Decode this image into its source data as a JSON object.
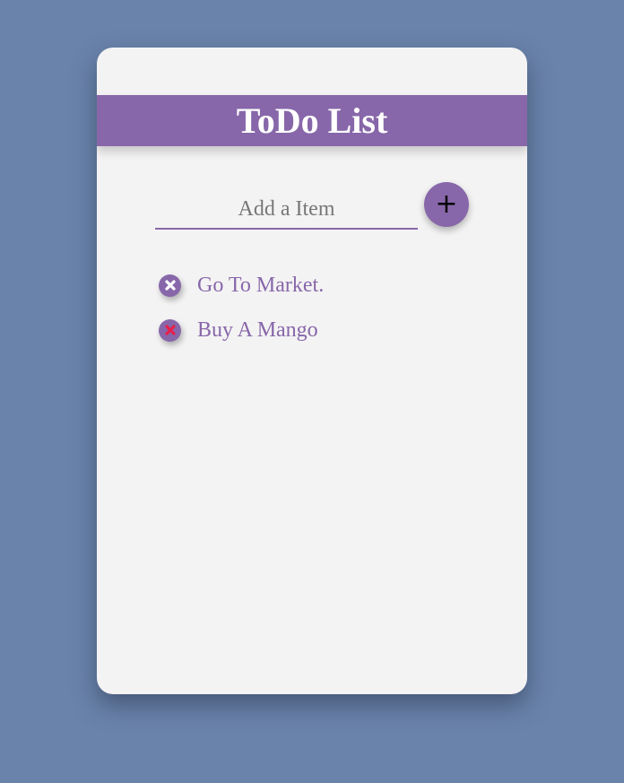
{
  "header": {
    "title": "ToDo List"
  },
  "input": {
    "placeholder": "Add a Item",
    "value": ""
  },
  "add_button": {
    "label": "+"
  },
  "items": [
    {
      "text": "Go To Market.",
      "delete_icon_color": "#ffffff"
    },
    {
      "text": "Buy A Mango",
      "delete_icon_color": "#e8204a"
    }
  ],
  "colors": {
    "background": "#6a83aa",
    "card": "#f4f3f4",
    "accent": "#8767a9"
  }
}
